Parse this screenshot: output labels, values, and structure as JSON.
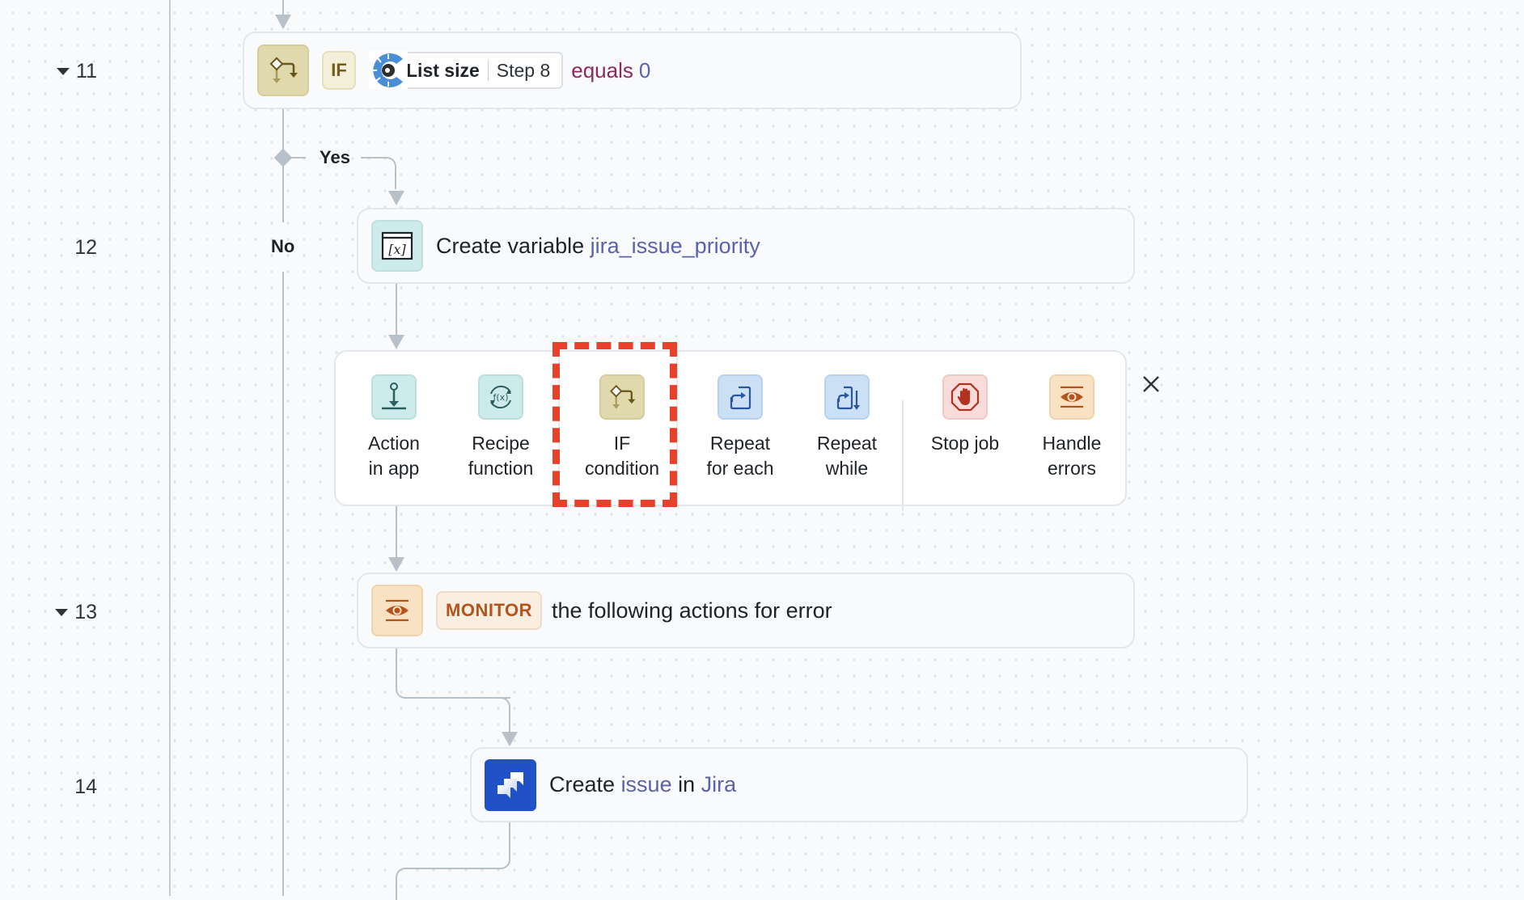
{
  "gutter": {
    "line_numbers": [
      {
        "label": "11",
        "collapsible": true
      },
      {
        "label": "12",
        "collapsible": false
      },
      {
        "label": "13",
        "collapsible": true
      },
      {
        "label": "14",
        "collapsible": false
      }
    ]
  },
  "steps": {
    "if_step": {
      "badge": "IF",
      "pill_field": "List size",
      "pill_step": "Step 8",
      "operator": "equals",
      "value": "0",
      "icon": "if-condition-icon",
      "app_icon": "workato-utilities-icon"
    },
    "branches": {
      "yes_label": "Yes",
      "no_label": "No"
    },
    "create_variable": {
      "prefix": "Create variable",
      "variable_name": "jira_issue_priority",
      "icon": "variable-icon"
    },
    "monitor": {
      "badge": "MONITOR",
      "text": "the following actions for error",
      "icon": "eye-icon"
    },
    "jira": {
      "verb": "Create",
      "object": "issue",
      "connector_word": "in",
      "app": "Jira",
      "icon": "jira-logo-icon"
    }
  },
  "picker": {
    "items": [
      {
        "label": "Action\nin app",
        "icon": "action-in-app-icon"
      },
      {
        "label": "Recipe\nfunction",
        "icon": "recipe-function-icon"
      },
      {
        "label": "IF\ncondition",
        "icon": "if-condition-icon",
        "highlighted": true
      },
      {
        "label": "Repeat\nfor each",
        "icon": "repeat-for-each-icon"
      },
      {
        "label": "Repeat\nwhile",
        "icon": "repeat-while-icon"
      },
      {
        "label": "Stop job",
        "icon": "stop-job-icon"
      },
      {
        "label": "Handle\nerrors",
        "icon": "handle-errors-icon"
      }
    ],
    "close_icon": "close-icon"
  },
  "colors": {
    "highlight": "#e8402a",
    "link_blue": "#5a62ad",
    "operator": "#8a2a5f",
    "monitor_badge": "#b5531d",
    "if_badge": "#735e1f",
    "jira_blue": "#2151c7"
  }
}
